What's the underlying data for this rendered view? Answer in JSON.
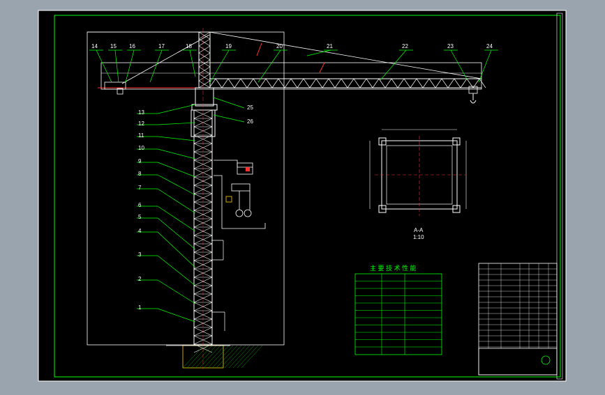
{
  "drawing": {
    "callouts_left": [
      "14",
      "15",
      "16",
      "17",
      "18",
      "19",
      "20",
      "21",
      "22",
      "23",
      "24"
    ],
    "callouts_side": [
      "13",
      "12",
      "11",
      "10",
      "9",
      "8",
      "7",
      "6",
      "5",
      "4",
      "3",
      "2",
      "1"
    ],
    "callouts_right": [
      "25",
      "26"
    ],
    "section_label": "A-A",
    "section_scale": "1:10",
    "spec_table_title": "主 要 技 术 性 能"
  },
  "colors": {
    "background": "#000000",
    "frame": "#00ff00",
    "structure": "#ffffff",
    "centerline": "#ff0000",
    "label": "#ffffff",
    "table": "#00ff00",
    "accent": "#ffff00"
  }
}
